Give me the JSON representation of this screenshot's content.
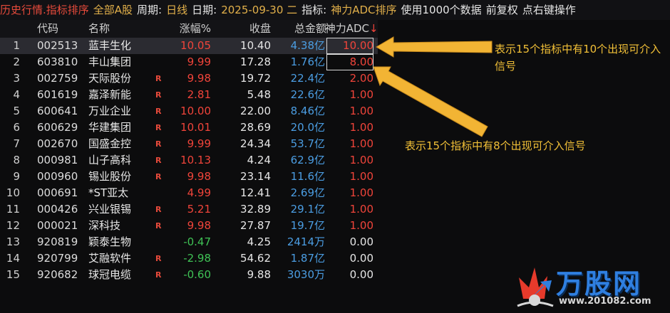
{
  "toolbar": {
    "title": "历史行情.指标排序",
    "market": "全部A股",
    "period_label": "周期:",
    "period_value": "日线",
    "date_label": "日期:",
    "date_value": "2025-09-30 二",
    "indicator_label": "指标:",
    "indicator_value": "神力ADC排序",
    "data_count": "使用1000个数据",
    "adjust": "前复权",
    "hint": "点右键操作"
  },
  "table": {
    "columns": [
      "代码",
      "名称",
      "涨幅%",
      "收盘",
      "总金额",
      "神力ADC"
    ],
    "sort_arrow": "↓",
    "rows": [
      {
        "no": "1",
        "code": "002513",
        "name": "蓝丰生化",
        "r": "",
        "pct": "10.05",
        "close": "10.40",
        "amount": "4.38亿",
        "adc": "10.00",
        "pct_color": "red",
        "adc_color": "red"
      },
      {
        "no": "2",
        "code": "603810",
        "name": "丰山集团",
        "r": "",
        "pct": "9.99",
        "close": "17.28",
        "amount": "1.76亿",
        "adc": "8.00",
        "pct_color": "red",
        "adc_color": "red"
      },
      {
        "no": "3",
        "code": "002759",
        "name": "天际股份",
        "r": "R",
        "pct": "9.98",
        "close": "19.72",
        "amount": "22.4亿",
        "adc": "2.00",
        "pct_color": "red",
        "adc_color": "red"
      },
      {
        "no": "4",
        "code": "601619",
        "name": "嘉泽新能",
        "r": "R",
        "pct": "2.81",
        "close": "5.48",
        "amount": "22.6亿",
        "adc": "1.00",
        "pct_color": "red",
        "adc_color": "red"
      },
      {
        "no": "5",
        "code": "600641",
        "name": "万业企业",
        "r": "R",
        "pct": "10.00",
        "close": "22.00",
        "amount": "8.46亿",
        "adc": "1.00",
        "pct_color": "red",
        "adc_color": "red"
      },
      {
        "no": "6",
        "code": "600629",
        "name": "华建集团",
        "r": "R",
        "pct": "10.01",
        "close": "28.69",
        "amount": "20.0亿",
        "adc": "1.00",
        "pct_color": "red",
        "adc_color": "red"
      },
      {
        "no": "7",
        "code": "002670",
        "name": "国盛金控",
        "r": "R",
        "pct": "9.99",
        "close": "24.34",
        "amount": "53.7亿",
        "adc": "1.00",
        "pct_color": "red",
        "adc_color": "red"
      },
      {
        "no": "8",
        "code": "000981",
        "name": "山子高科",
        "r": "R",
        "pct": "10.13",
        "close": "4.24",
        "amount": "62.9亿",
        "adc": "1.00",
        "pct_color": "red",
        "adc_color": "red"
      },
      {
        "no": "9",
        "code": "000960",
        "name": "锡业股份",
        "r": "R",
        "pct": "9.98",
        "close": "23.14",
        "amount": "11.6亿",
        "adc": "1.00",
        "pct_color": "red",
        "adc_color": "red"
      },
      {
        "no": "10",
        "code": "000691",
        "name": "*ST亚太",
        "r": "",
        "pct": "4.99",
        "close": "12.41",
        "amount": "2.69亿",
        "adc": "1.00",
        "pct_color": "red",
        "adc_color": "red"
      },
      {
        "no": "11",
        "code": "000426",
        "name": "兴业银锡",
        "r": "R",
        "pct": "5.21",
        "close": "32.89",
        "amount": "29.1亿",
        "adc": "1.00",
        "pct_color": "red",
        "adc_color": "red"
      },
      {
        "no": "12",
        "code": "000021",
        "name": "深科技",
        "r": "R",
        "pct": "9.98",
        "close": "27.87",
        "amount": "19.7亿",
        "adc": "1.00",
        "pct_color": "red",
        "adc_color": "red"
      },
      {
        "no": "13",
        "code": "920819",
        "name": "颖泰生物",
        "r": "",
        "pct": "-0.47",
        "close": "4.25",
        "amount": "2414万",
        "adc": "0.00",
        "pct_color": "green",
        "adc_color": "white"
      },
      {
        "no": "14",
        "code": "920799",
        "name": "艾融软件",
        "r": "R",
        "pct": "-2.98",
        "close": "54.62",
        "amount": "1.87亿",
        "adc": "0.00",
        "pct_color": "green",
        "adc_color": "white"
      },
      {
        "no": "15",
        "code": "920682",
        "name": "球冠电缆",
        "r": "R",
        "pct": "-0.60",
        "close": "9.88",
        "amount": "3030万",
        "adc": "0.00",
        "pct_color": "green",
        "adc_color": "white"
      }
    ]
  },
  "annotations": {
    "note1": "表示15个指标中有10个出现可介入信号",
    "note2": "表示15个指标中有8个出现可介入信号"
  },
  "watermark": {
    "brand": "万股网",
    "url": "www.201082.com"
  },
  "colors": {
    "up": "#f0443a",
    "down": "#3fc255",
    "amount": "#4b9de2",
    "annotation": "#f2c037"
  }
}
